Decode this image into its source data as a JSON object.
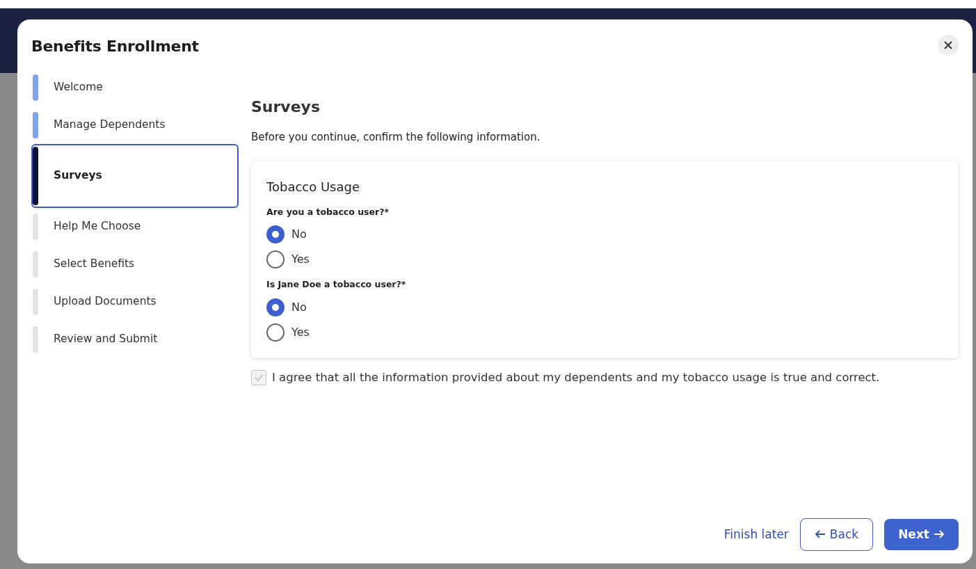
{
  "modal": {
    "title": "Benefits Enrollment"
  },
  "steps": [
    {
      "label": "Welcome",
      "completed": true,
      "selected": false
    },
    {
      "label": "Manage Dependents",
      "completed": true,
      "selected": false
    },
    {
      "label": "Surveys",
      "completed": false,
      "selected": true
    },
    {
      "label": "Help Me Choose",
      "completed": false,
      "selected": false
    },
    {
      "label": "Select Benefits",
      "completed": false,
      "selected": false
    },
    {
      "label": "Upload Documents",
      "completed": false,
      "selected": false
    },
    {
      "label": "Review and Submit",
      "completed": false,
      "selected": false
    }
  ],
  "page": {
    "heading": "Surveys",
    "intro": "Before you continue, confirm the following information."
  },
  "survey": {
    "title": "Tobacco Usage",
    "questions": [
      {
        "label": "Are you a tobacco user?*",
        "options": [
          {
            "label": "No",
            "selected": true
          },
          {
            "label": "Yes",
            "selected": false
          }
        ]
      },
      {
        "label": "Is Jane Doe a tobacco user?*",
        "options": [
          {
            "label": "No",
            "selected": true
          },
          {
            "label": "Yes",
            "selected": false
          }
        ]
      }
    ]
  },
  "agreement": {
    "label": "I agree that all the information provided about my dependents and my tobacco usage is true and correct.",
    "checked": true,
    "disabled": true
  },
  "footer": {
    "finish_later": "Finish later",
    "back": "Back",
    "next": "Next"
  }
}
